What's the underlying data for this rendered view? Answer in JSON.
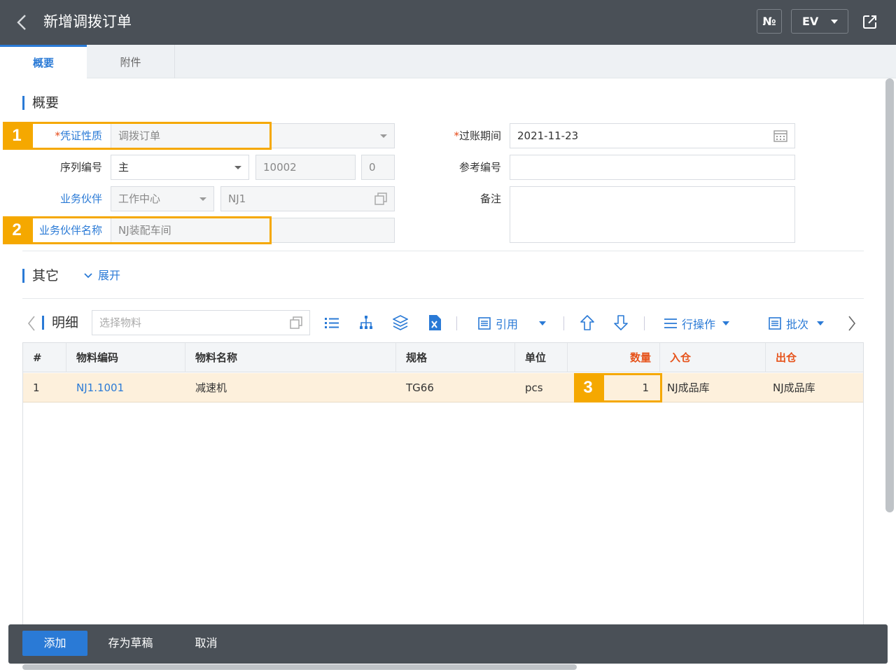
{
  "header": {
    "title": "新增调拨订单",
    "number_button": "№",
    "ev_button": "EV"
  },
  "tabs": [
    {
      "label": "概要",
      "active": true
    },
    {
      "label": "附件",
      "active": false
    }
  ],
  "overview": {
    "section_title": "概要",
    "voucher_type": {
      "required_mark": "*",
      "label": "凭证性质",
      "value": "调拨订单"
    },
    "series": {
      "label": "序列编号",
      "value": "主",
      "number": "10002",
      "index": "0"
    },
    "partner": {
      "label": "业务伙伴",
      "type": "工作中心",
      "code": "NJ1"
    },
    "partner_name": {
      "label": "业务伙伴名称",
      "value": "NJ装配车间"
    },
    "posting_date": {
      "required_mark": "*",
      "label": "过账期间",
      "value": "2021-11-23"
    },
    "reference": {
      "label": "参考编号",
      "value": ""
    },
    "remarks": {
      "label": "备注",
      "value": ""
    }
  },
  "other": {
    "section_title": "其它",
    "expand_label": "展开"
  },
  "detail": {
    "title": "明细",
    "search_placeholder": "选择物料",
    "cite_label": "引用",
    "row_ops_label": "行操作",
    "batch_label": "批次",
    "columns": [
      "#",
      "物料编码",
      "物料名称",
      "规格",
      "单位",
      "数量",
      "入仓",
      "出仓"
    ],
    "rows": [
      {
        "index": "1",
        "code": "NJ1.1001",
        "name": "减速机",
        "spec": "TG66",
        "unit": "pcs",
        "qty": "1",
        "in_wh": "NJ成品库",
        "out_wh": "NJ成品库"
      }
    ]
  },
  "callouts": [
    "1",
    "2",
    "3"
  ],
  "footer": {
    "add_label": "添加",
    "draft_label": "存为草稿",
    "cancel_label": "取消"
  },
  "colors": {
    "header_bg": "#4a5057",
    "accent": "#2a7ad6",
    "callout": "#f5a800",
    "highlight_row": "#fdf0dc",
    "required": "#e6531b"
  }
}
